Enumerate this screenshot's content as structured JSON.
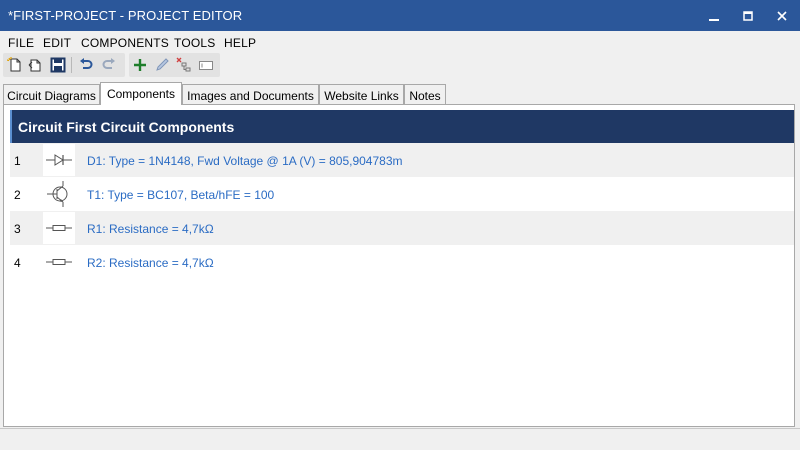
{
  "window": {
    "title": "*FIRST-PROJECT - PROJECT EDITOR"
  },
  "menu": [
    "FILE",
    "EDIT",
    "COMPONENTS",
    "TOOLS",
    "HELP"
  ],
  "toolbar": {
    "icons": [
      "new-file-icon",
      "open-file-icon",
      "save-icon",
      "undo-icon",
      "redo-icon",
      "add-icon",
      "edit-icon",
      "delete-icon",
      "rename-icon"
    ]
  },
  "tabs": [
    {
      "label": "Circuit Diagrams",
      "active": false
    },
    {
      "label": "Components",
      "active": true
    },
    {
      "label": "Images and Documents",
      "active": false
    },
    {
      "label": "Website Links",
      "active": false
    },
    {
      "label": "Notes",
      "active": false
    }
  ],
  "header": {
    "title": "Circuit First Circuit Components"
  },
  "components": [
    {
      "index": "1",
      "icon": "diode-icon",
      "description": "D1: Type = 1N4148, Fwd Voltage @ 1A (V) = 805,904783m"
    },
    {
      "index": "2",
      "icon": "transistor-icon",
      "description": "T1: Type = BC107, Beta/hFE = 100"
    },
    {
      "index": "3",
      "icon": "resistor-icon",
      "description": "R1: Resistance = 4,7kΩ"
    },
    {
      "index": "4",
      "icon": "resistor-icon",
      "description": "R2: Resistance = 4,7kΩ"
    }
  ],
  "colors": {
    "titlebar": "#2b579a",
    "header": "#1f3864",
    "link": "#2b6cc4"
  }
}
